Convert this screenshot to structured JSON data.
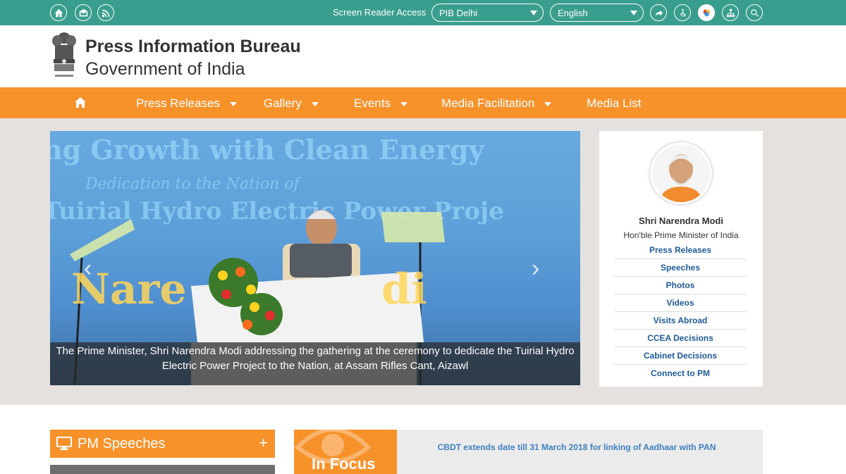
{
  "topbar": {
    "screen_reader": "Screen Reader Access",
    "region_select": "PIB Delhi",
    "language_select": "English"
  },
  "header": {
    "org_name": "Press Information Bureau",
    "org_sub": "Government of India"
  },
  "nav": {
    "items": [
      {
        "label": "Press Releases"
      },
      {
        "label": "Gallery"
      },
      {
        "label": "Events"
      },
      {
        "label": "Media Facilitation"
      },
      {
        "label": "Media List"
      }
    ]
  },
  "slider": {
    "caption": "The Prime Minister, Shri Narendra Modi addressing the gathering at the ceremony to dedicate the Tuirial Hydro Electric Power Project to the Nation, at Assam Rifles Cant, Aizawl",
    "banner_line1": "ng Growth with Clean Energy",
    "banner_line2": "Dedication to the Nation of",
    "banner_line3": "Tuirial Hydro Electric Power Proje"
  },
  "pm_card": {
    "name": "Shri Narendra Modi",
    "title": "Hon'ble Prime Minister of India",
    "links": [
      "Press Releases",
      "Speeches",
      "Photos",
      "Videos",
      "Visits Abroad",
      "CCEA Decisions",
      "Cabinet Decisions",
      "Connect to PM"
    ]
  },
  "speeches": {
    "label": "PM Speeches",
    "expand": "+"
  },
  "focus": {
    "label": "In Focus",
    "news": "CBDT extends date till 31 March 2018 for linking of Aadhaar with PAN"
  },
  "colors": {
    "topbar": "#3a9e8e",
    "nav": "#f7922b",
    "link": "#1e5a96"
  }
}
